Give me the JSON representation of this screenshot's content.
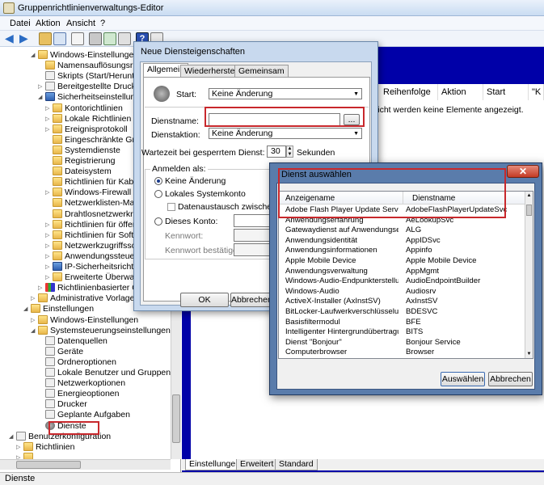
{
  "window": {
    "title": "Gruppenrichtlinienverwaltungs-Editor"
  },
  "menu": {
    "items": [
      "Datei",
      "Aktion",
      "Ansicht",
      "?"
    ]
  },
  "tree": {
    "items": [
      {
        "label": "Windows-Einstellungen",
        "icon": "folder-icon",
        "depth": 4,
        "tw": "◢"
      },
      {
        "label": "Namensauflösungsrichtlinie",
        "icon": "folder-icon",
        "depth": 5,
        "tw": ""
      },
      {
        "label": "Skripts (Start/Herunterfahren)",
        "icon": "script-icon",
        "depth": 5,
        "tw": ""
      },
      {
        "label": "Bereitgestellte Drucker",
        "icon": "printer-icon",
        "depth": 5,
        "tw": "▷"
      },
      {
        "label": "Sicherheitseinstellungen",
        "icon": "shield-icon",
        "depth": 5,
        "tw": "◢"
      },
      {
        "label": "Kontorichtlinien",
        "icon": "folder-icon",
        "depth": 6,
        "tw": "▷"
      },
      {
        "label": "Lokale Richtlinien",
        "icon": "folder-icon",
        "depth": 6,
        "tw": "▷"
      },
      {
        "label": "Ereignisprotokoll",
        "icon": "folder-icon",
        "depth": 6,
        "tw": "▷"
      },
      {
        "label": "Eingeschränkte Gruppen",
        "icon": "folder-icon",
        "depth": 6,
        "tw": ""
      },
      {
        "label": "Systemdienste",
        "icon": "folder-icon",
        "depth": 6,
        "tw": ""
      },
      {
        "label": "Registrierung",
        "icon": "folder-icon",
        "depth": 6,
        "tw": ""
      },
      {
        "label": "Dateisystem",
        "icon": "folder-icon",
        "depth": 6,
        "tw": ""
      },
      {
        "label": "Richtlinien für Kabelnetzwerke",
        "icon": "folder-icon",
        "depth": 6,
        "tw": ""
      },
      {
        "label": "Windows-Firewall mit erweiterter Sicherheit",
        "icon": "folder-icon",
        "depth": 6,
        "tw": "▷"
      },
      {
        "label": "Netzwerklisten-Manager-Richtlinien",
        "icon": "folder-icon",
        "depth": 6,
        "tw": ""
      },
      {
        "label": "Drahtlosnetzwerkrichtlinien",
        "icon": "folder-icon",
        "depth": 6,
        "tw": ""
      },
      {
        "label": "Richtlinien für öffentliche Schlüssel",
        "icon": "folder-icon",
        "depth": 6,
        "tw": "▷"
      },
      {
        "label": "Richtlinien für Softwareeinschränkung",
        "icon": "folder-icon",
        "depth": 6,
        "tw": "▷"
      },
      {
        "label": "Netzwerkzugriffsschutz",
        "icon": "folder-icon",
        "depth": 6,
        "tw": "▷"
      },
      {
        "label": "Anwendungssteuerungsrichtlinien",
        "icon": "folder-icon",
        "depth": 6,
        "tw": "▷"
      },
      {
        "label": "IP-Sicherheitsrichtlinien",
        "icon": "shield-icon",
        "depth": 6,
        "tw": "▷"
      },
      {
        "label": "Erweiterte Überwachungsrichtlinienkonfiguration",
        "icon": "folder-icon",
        "depth": 6,
        "tw": "▷"
      },
      {
        "label": "Richtlinienbasierter QoS",
        "icon": "chart-icon",
        "depth": 5,
        "tw": "▷"
      },
      {
        "label": "Administrative Vorlagen:",
        "icon": "folder-icon",
        "depth": 4,
        "tw": "▷"
      },
      {
        "label": "Einstellungen",
        "icon": "folder-icon",
        "depth": 3,
        "tw": "◢"
      },
      {
        "label": "Windows-Einstellungen",
        "icon": "folder-icon",
        "depth": 4,
        "tw": "▷"
      },
      {
        "label": "Systemsteuerungseinstellungen",
        "icon": "folder-icon",
        "depth": 4,
        "tw": "◢"
      },
      {
        "label": "Datenquellen",
        "icon": "datasource-icon",
        "depth": 5,
        "tw": ""
      },
      {
        "label": "Geräte",
        "icon": "device-icon",
        "depth": 5,
        "tw": ""
      },
      {
        "label": "Ordneroptionen",
        "icon": "folder-options-icon",
        "depth": 5,
        "tw": ""
      },
      {
        "label": "Lokale Benutzer und Gruppen",
        "icon": "users-icon",
        "depth": 5,
        "tw": ""
      },
      {
        "label": "Netzwerkoptionen",
        "icon": "network-icon",
        "depth": 5,
        "tw": ""
      },
      {
        "label": "Energieoptionen",
        "icon": "power-icon",
        "depth": 5,
        "tw": ""
      },
      {
        "label": "Drucker",
        "icon": "printer-icon",
        "depth": 5,
        "tw": ""
      },
      {
        "label": "Geplante Aufgaben",
        "icon": "task-icon",
        "depth": 5,
        "tw": ""
      },
      {
        "label": "Dienste",
        "icon": "gear-icon",
        "depth": 5,
        "tw": ""
      },
      {
        "label": "Benutzerkonfiguration",
        "icon": "user-config-icon",
        "depth": 1,
        "tw": "◢"
      },
      {
        "label": "Richtlinien",
        "icon": "folder-icon",
        "depth": 2,
        "tw": "▷"
      },
      {
        "label": "",
        "icon": "folder-icon",
        "depth": 2,
        "tw": "▷"
      }
    ]
  },
  "right_pane": {
    "columns": [
      "",
      "Reihenfolge",
      "Aktion",
      "Start",
      "\"K"
    ],
    "empty_message": "sicht werden keine Elemente angezeigt."
  },
  "bottom_tabs": [
    "Einstellungen",
    "Erweitert",
    "Standard"
  ],
  "status": "Dienste",
  "dialog_props": {
    "title": "Neue Diensteigenschaften",
    "tabs": [
      "Allgemein",
      "Wiederherstellung",
      "Gemeinsam"
    ],
    "start_label": "Start:",
    "start_value": "Keine Änderung",
    "service_name_label": "Dienstname:",
    "service_name_value": "",
    "browse_label": "...",
    "service_action_label": "Dienstaktion:",
    "service_action_value": "Keine Änderung",
    "wait_label": "Wartezeit bei gesperrtem Dienst:",
    "wait_value": "30",
    "wait_unit": "Sekunden",
    "logon_label": "Anmelden als:",
    "radio_no_change": "Keine Änderung",
    "radio_local_system": "Lokales Systemkonto",
    "checkbox_desktop": "Datenaustausch zwischen Dienst",
    "radio_this_account": "Dieses Konto:",
    "password_label": "Kennwort:",
    "password_confirm_label": "Kennwort bestätigen:",
    "ok_label": "OK",
    "cancel_label": "Abbrechen"
  },
  "dialog_select": {
    "title": "Dienst auswählen",
    "close_label": "✕",
    "col_display": "Anzeigename",
    "col_service": "Dienstname",
    "rows": [
      {
        "display": "Adobe Flash Player Update Service",
        "service": "AdobeFlashPlayerUpdateSvc"
      },
      {
        "display": "Anwendungserfahrung",
        "service": "AeLookupSvc"
      },
      {
        "display": "Gatewaydienst auf Anwendungsebene",
        "service": "ALG"
      },
      {
        "display": "Anwendungsidentität",
        "service": "AppIDSvc"
      },
      {
        "display": "Anwendungsinformationen",
        "service": "Appinfo"
      },
      {
        "display": "Apple Mobile Device",
        "service": "Apple Mobile Device"
      },
      {
        "display": "Anwendungsverwaltung",
        "service": "AppMgmt"
      },
      {
        "display": "Windows-Audio-Endpunkterstellung",
        "service": "AudioEndpointBuilder"
      },
      {
        "display": "Windows-Audio",
        "service": "Audiosrv"
      },
      {
        "display": "ActiveX-Installer (AxInstSV)",
        "service": "AxInstSV"
      },
      {
        "display": "BitLocker-Laufwerkverschlüsselungsdi...",
        "service": "BDESVC"
      },
      {
        "display": "Basisfiltermodul",
        "service": "BFE"
      },
      {
        "display": "Intelligenter Hintergrundübertragungsdi...",
        "service": "BITS"
      },
      {
        "display": "Dienst \"Bonjour\"",
        "service": "Bonjour Service"
      },
      {
        "display": "Computerbrowser",
        "service": "Browser"
      }
    ],
    "select_label": "Auswählen",
    "cancel_label": "Abbrechen"
  }
}
